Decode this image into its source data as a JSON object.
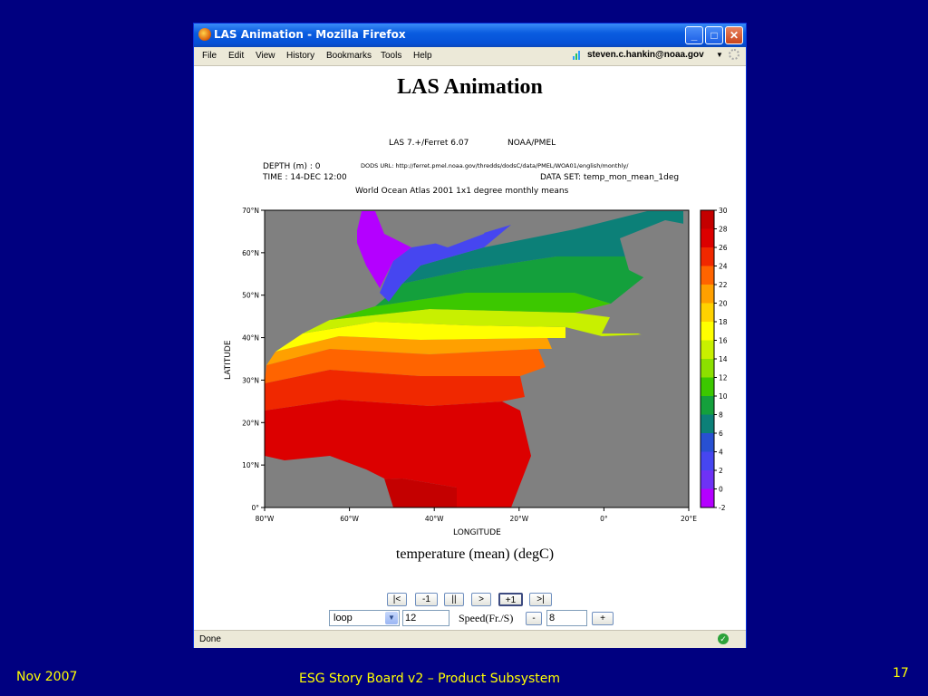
{
  "window": {
    "title": "LAS Animation - Mozilla Firefox"
  },
  "menu": {
    "items": [
      "File",
      "Edit",
      "View",
      "History",
      "Bookmarks",
      "Tools",
      "Help"
    ],
    "user": "steven.c.hankin@noaa.gov"
  },
  "page": {
    "heading": "LAS Animation"
  },
  "plot": {
    "header_line": "LAS 7.+/Ferret 6.07",
    "header_org": "NOAA/PMEL",
    "depth": "DEPTH (m) : 0",
    "time": "TIME : 14-DEC 12:00",
    "dods_url": "DODS URL: http://ferret.pmel.noaa.gov/thredds/dodsC/data/PMEL/WOA01/english/monthly/",
    "dataset": "DATA SET: temp_mon_mean_1deg",
    "subtitle": "World Ocean Atlas 2001 1x1 degree monthly means",
    "xlabel": "LONGITUDE",
    "ylabel": "LATITUDE",
    "xticks": [
      "80°W",
      "60°W",
      "40°W",
      "20°W",
      "0°",
      "20°E"
    ],
    "yticks": [
      "70°N",
      "60°N",
      "50°N",
      "40°N",
      "30°N",
      "20°N",
      "10°N",
      "0°"
    ],
    "colorbar_ticks": [
      "30",
      "28",
      "26",
      "24",
      "22",
      "20",
      "18",
      "16",
      "14",
      "12",
      "10",
      "8",
      "6",
      "4",
      "2",
      "0",
      "-2"
    ],
    "colorbar_colors": [
      "#c40000",
      "#dc0000",
      "#f02800",
      "#ff6400",
      "#ffa000",
      "#ffd200",
      "#ffff00",
      "#c8f000",
      "#8ce000",
      "#3cc800",
      "#14a03c",
      "#0c8078",
      "#2850d2",
      "#4646f0",
      "#6e32f5",
      "#b400ff"
    ],
    "variable": "temperature (mean) (degC)"
  },
  "controls": {
    "buttons": [
      "|<",
      "-1",
      "||",
      ">",
      "+1",
      ">|"
    ],
    "loop_select": "loop",
    "frames": "12",
    "speed_label": "Speed(Fr./S)",
    "speed_minus": "-",
    "speed_value": "8",
    "speed_plus": "+"
  },
  "status": {
    "text": "Done"
  },
  "slide": {
    "date": "Nov 2007",
    "footer_title": "ESG Story Board v2 – Product Subsystem",
    "page_number": "17"
  },
  "colors": {
    "slide_bg": "#000080",
    "footer_text": "#ffff00",
    "land": "#808080"
  }
}
